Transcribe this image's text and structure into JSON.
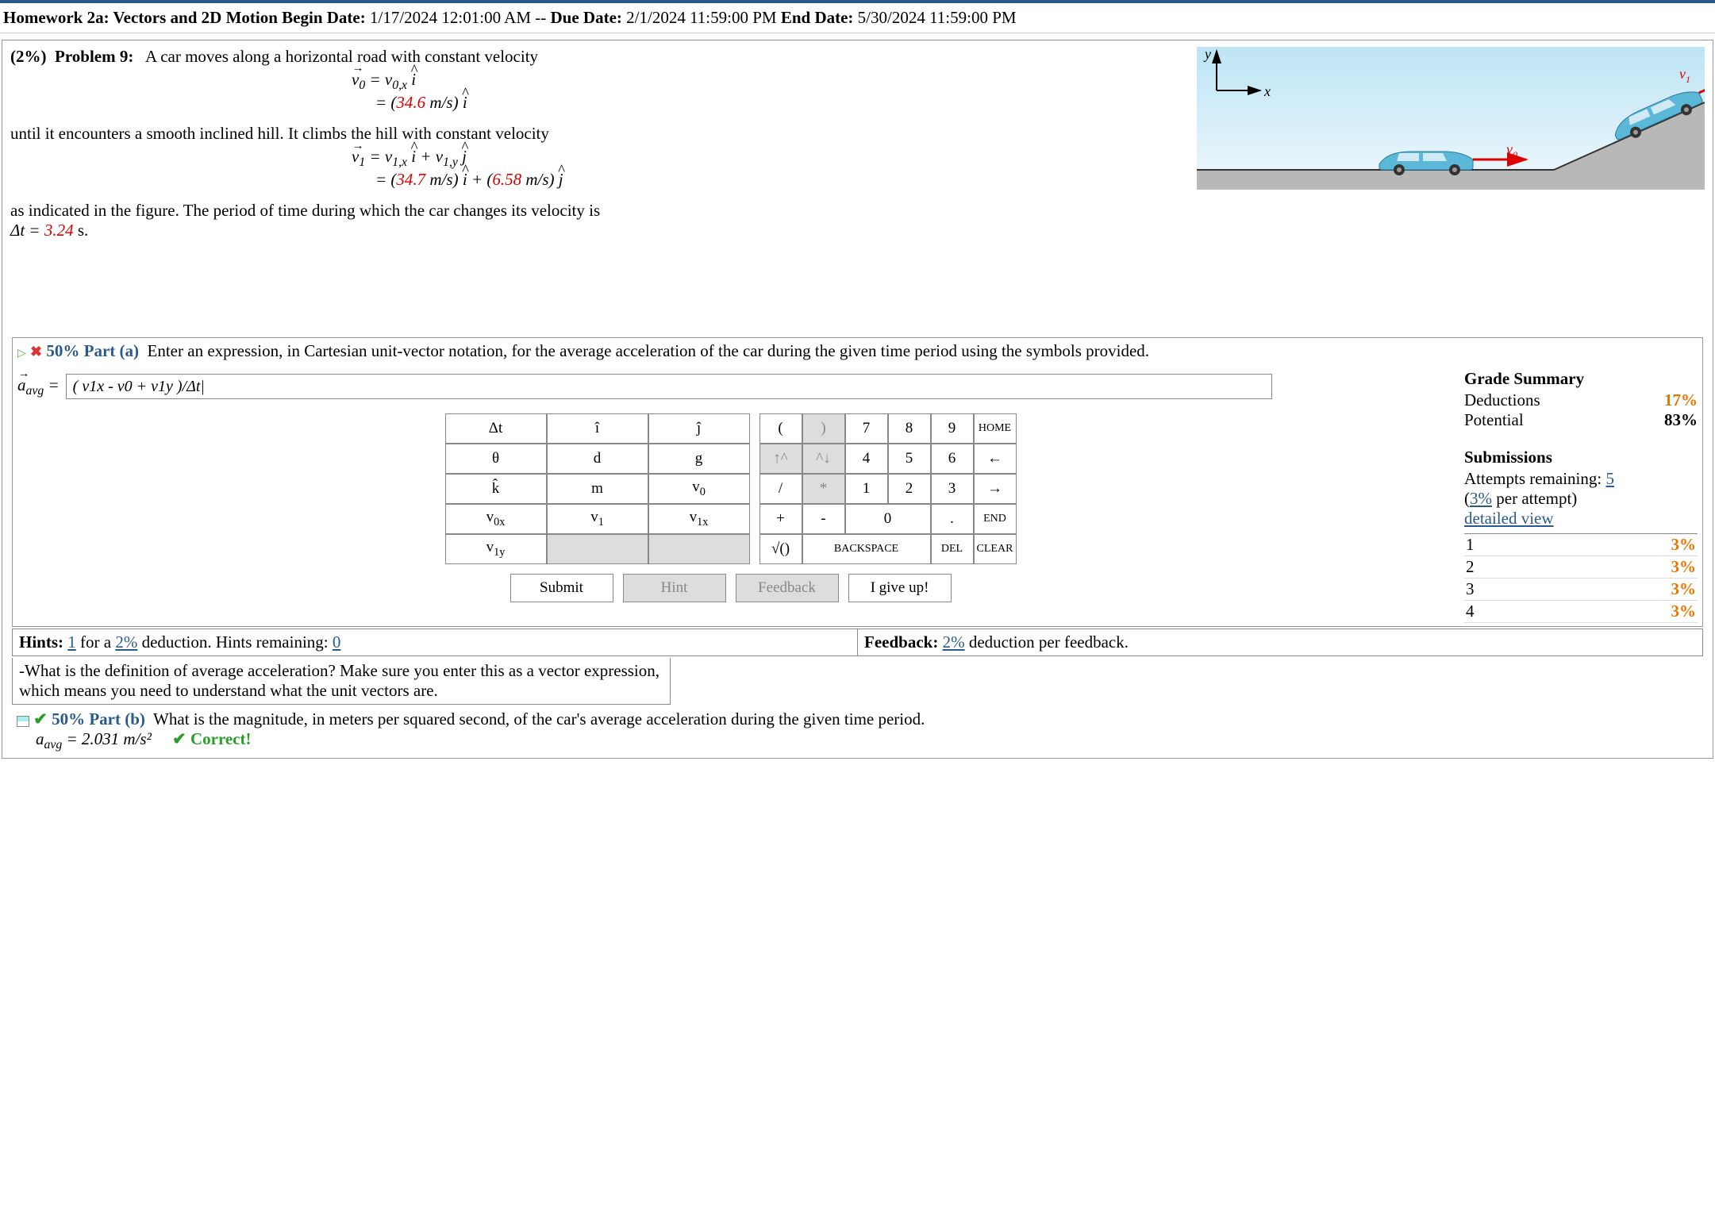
{
  "header": {
    "title": "Homework 2a: Vectors and 2D Motion",
    "begin_label": "Begin Date:",
    "begin": "1/17/2024 12:01:00 AM",
    "sep": "--",
    "due_label": "Due Date:",
    "due": "2/1/2024 11:59:00 PM",
    "end_label": "End Date:",
    "end": "5/30/2024 11:59:00 PM"
  },
  "problem": {
    "weight": "(2%)",
    "label": "Problem 9:",
    "intro": "A car moves along a horizontal road with constant velocity",
    "v0_line1_a": "v",
    "v0_line1_b": "0",
    "v0_line1_c": " = v",
    "v0_line1_d": "0,x",
    "v0_line1_e": " i",
    "v0_line2_a": "= (",
    "v0_line2_val": "34.6",
    "v0_line2_b": " m/s) ",
    "v0_line2_c": "i",
    "mid": "until it encounters a smooth inclined hill. It climbs the hill with constant velocity",
    "v1_line1_a": "v",
    "v1_line1_b": "1",
    "v1_line1_c": " = v",
    "v1_line1_d": "1,x",
    "v1_line1_e": " i",
    "v1_line1_f": " + v",
    "v1_line1_g": "1,y",
    "v1_line1_h": " j",
    "v1_line2_a": "= (",
    "v1_line2_v1": "34.7",
    "v1_line2_b": " m/s) ",
    "v1_line2_c": "i",
    "v1_line2_d": " + (",
    "v1_line2_v2": "6.58",
    "v1_line2_e": " m/s) ",
    "v1_line2_f": "j",
    "tail1": "as indicated in the figure. The period of time during which the car changes its velocity is ",
    "dt_a": "Δt = ",
    "dt_val": "3.24",
    "dt_b": " s."
  },
  "figure": {
    "y": "y",
    "x": "x",
    "v0": "v",
    "v0s": "0",
    "v1": "v",
    "v1s": "1"
  },
  "partA": {
    "pct": "50% Part (a)",
    "prompt": "Enter an expression, in Cartesian unit-vector notation, for the average acceleration of the car during the given time period using the symbols provided.",
    "lhs_a": "a",
    "lhs_b": "avg",
    "lhs_c": " = ",
    "answer": "( v1x - v0 + v1y )/Δt|"
  },
  "grade": {
    "title": "Grade Summary",
    "ded_label": "Deductions",
    "ded_val": "17%",
    "pot_label": "Potential",
    "pot_val": "83%",
    "sub_title": "Submissions",
    "att_a": "Attempts remaining: ",
    "att_n": "5",
    "per_a": "(",
    "per_n": "3%",
    "per_b": " per attempt)",
    "detailed": "detailed view",
    "rows": [
      {
        "n": "1",
        "v": "3%"
      },
      {
        "n": "2",
        "v": "3%"
      },
      {
        "n": "3",
        "v": "3%"
      },
      {
        "n": "4",
        "v": "3%"
      }
    ]
  },
  "symbols": {
    "r1": [
      "Δt",
      "î",
      "ĵ"
    ],
    "r2": [
      "θ",
      "d",
      "g"
    ],
    "r3": [
      "k̂",
      "m",
      "v0"
    ],
    "r4": [
      "v0x",
      "v1",
      "v1x"
    ],
    "r5": [
      "v1y",
      "",
      ""
    ]
  },
  "keypad": {
    "r1": [
      "(",
      ")",
      "7",
      "8",
      "9",
      "HOME"
    ],
    "r2": [
      "↑^",
      "^↓",
      "4",
      "5",
      "6",
      "←"
    ],
    "r3": [
      "/",
      "*",
      "1",
      "2",
      "3",
      "→"
    ],
    "r4": [
      "+",
      "-",
      "0",
      ".",
      "END"
    ],
    "r5": [
      "√()",
      "BACKSPACE",
      "DEL",
      "CLEAR"
    ]
  },
  "buttons": {
    "submit": "Submit",
    "hint": "Hint",
    "feedback": "Feedback",
    "giveup": "I give up!"
  },
  "hints": {
    "left_a": "Hints: ",
    "left_n": "1",
    "left_b": " for a ",
    "left_p": "2%",
    "left_c": " deduction. Hints remaining: ",
    "left_r": "0",
    "right_a": "Feedback: ",
    "right_p": "2%",
    "right_b": " deduction per feedback.",
    "text": "-What is the definition of average acceleration? Make sure you enter this as a vector expression, which means you need to understand what the unit vectors are."
  },
  "partB": {
    "pct": "50% Part (b)",
    "prompt": "What is the magnitude, in meters per squared second, of the car's average acceleration during the given time period.",
    "ans_a": "a",
    "ans_b": "avg",
    "ans_c": " = 2.031 m/s²",
    "correct": "✔ Correct!"
  }
}
